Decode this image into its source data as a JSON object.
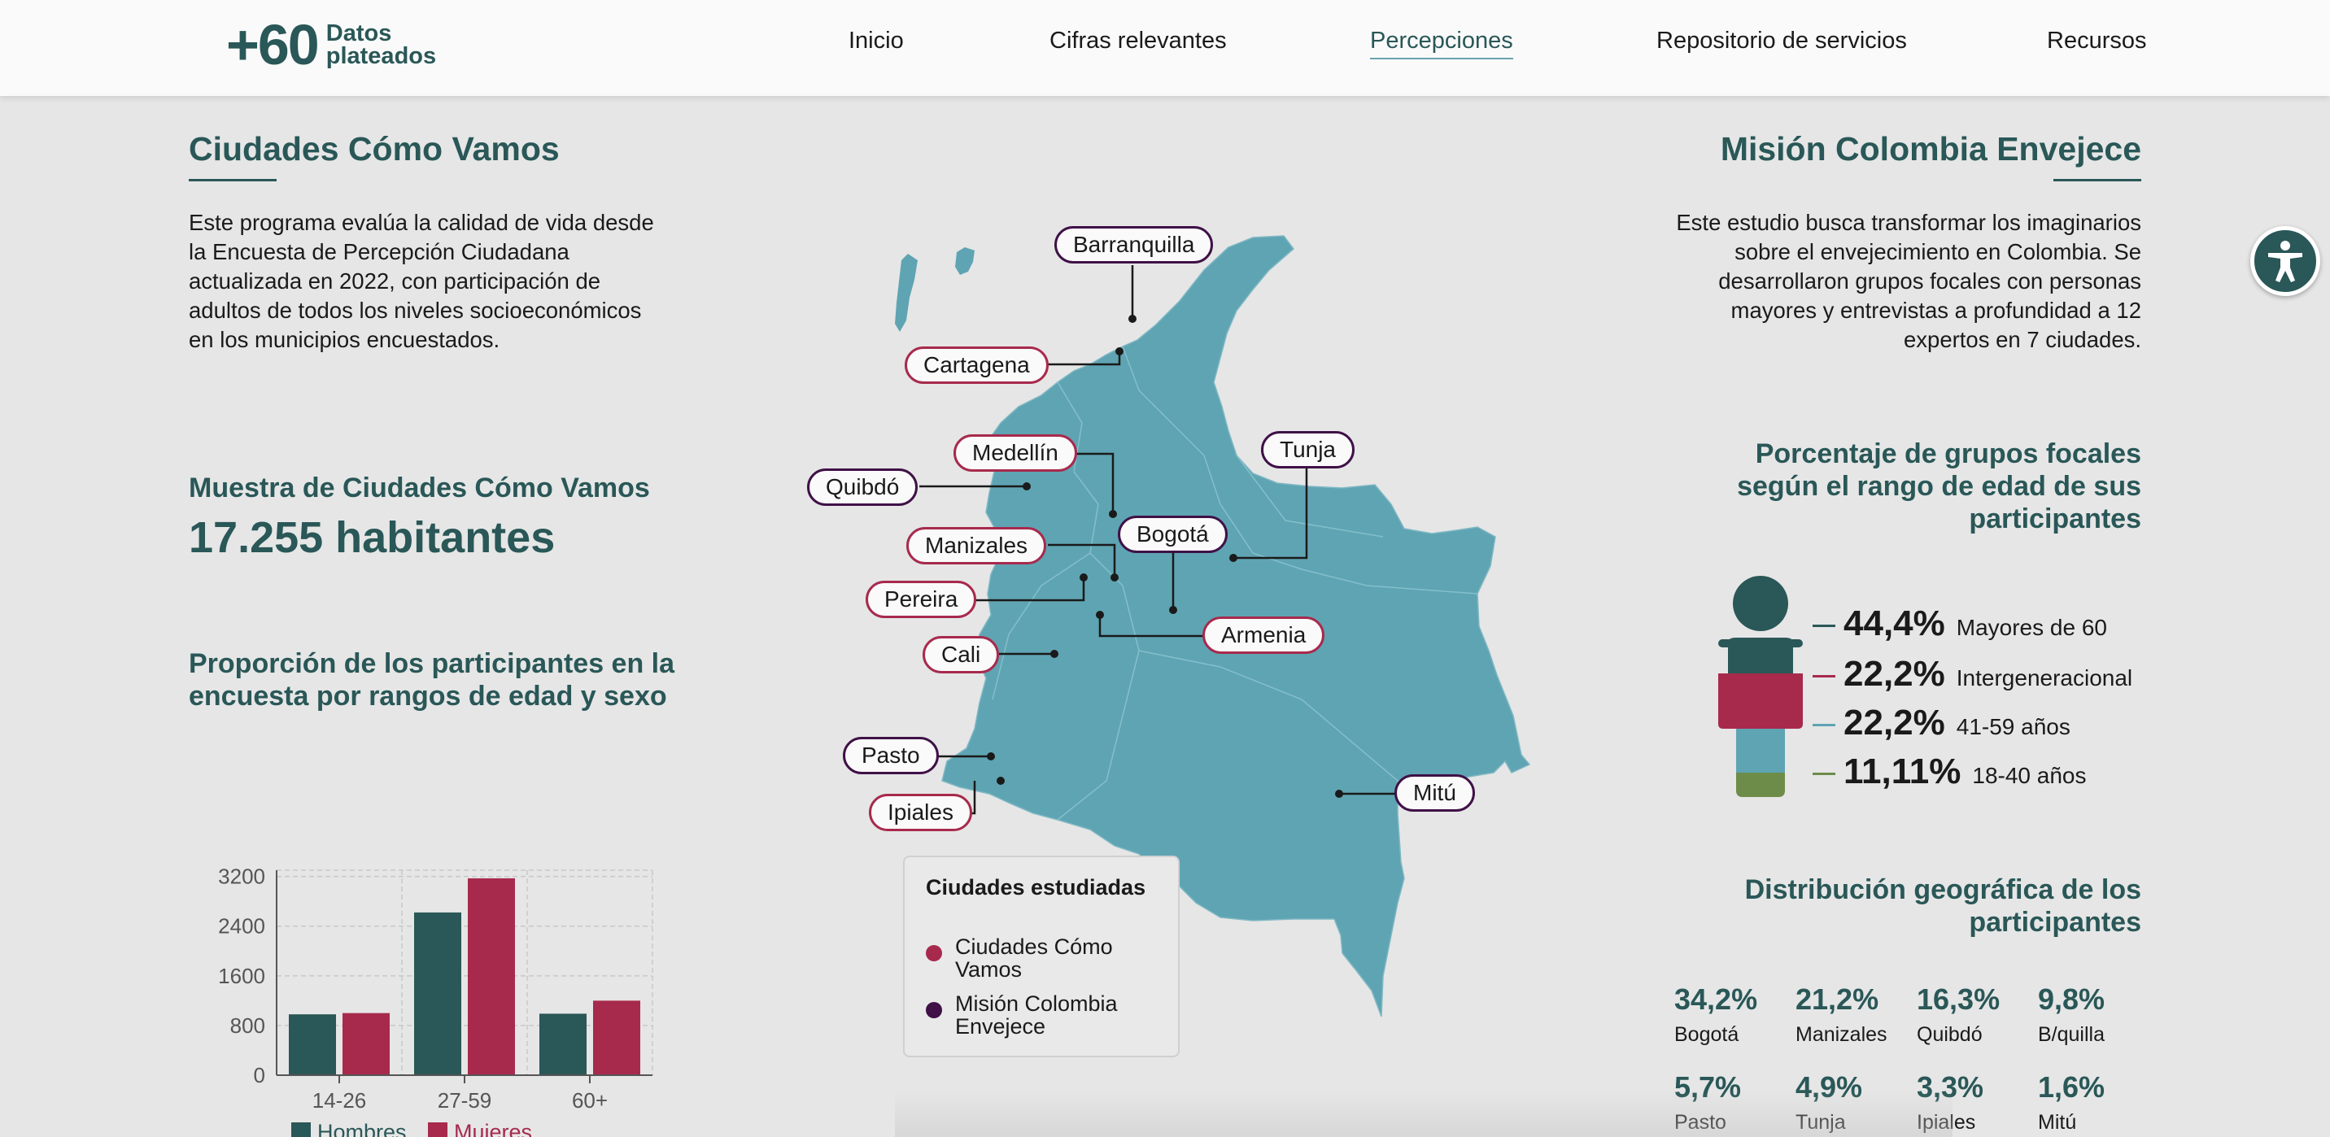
{
  "header": {
    "logo_number": "+60",
    "logo_line1": "Datos",
    "logo_line2": "plateados",
    "nav": [
      {
        "label": "Inicio",
        "active": false
      },
      {
        "label": "Cifras relevantes",
        "active": false
      },
      {
        "label": "Percepciones",
        "active": true
      },
      {
        "label": "Repositorio de servicios",
        "active": false
      },
      {
        "label": "Recursos",
        "active": false
      }
    ]
  },
  "left": {
    "title": "Ciudades Cómo Vamos",
    "description": "Este programa evalúa la calidad de vida desde la Encuesta de Percepción Ciudadana actualizada en 2022, con participación de adultos de todos los niveles socioeconómicos en los municipios encuestados.",
    "sample_title": "Muestra de Ciudades Cómo Vamos",
    "sample_value": "17.255 habitantes",
    "chart_title": "Proporción de los participantes en la encuesta por rangos de edad y sexo"
  },
  "chart_data": {
    "type": "bar",
    "title": "Proporción de los participantes en la encuesta por rangos de edad y sexo",
    "categories": [
      "14-26",
      "27-59",
      "60+"
    ],
    "series": [
      {
        "name": "Hombres",
        "color": "#2a5757",
        "values": [
          980,
          2620,
          990
        ]
      },
      {
        "name": "Mujeres",
        "color": "#a72a4d",
        "values": [
          1000,
          3170,
          1200
        ]
      }
    ],
    "yticks": [
      0,
      800,
      1600,
      2400,
      3200
    ],
    "ylim": [
      0,
      3300
    ],
    "grid": true,
    "legend": "bottom"
  },
  "map": {
    "fill_color": "#5fa4b3",
    "cities": [
      {
        "name": "Barranquilla",
        "group": "mision"
      },
      {
        "name": "Cartagena",
        "group": "ccv"
      },
      {
        "name": "Medellín",
        "group": "ccv"
      },
      {
        "name": "Quibdó",
        "group": "mision"
      },
      {
        "name": "Tunja",
        "group": "mision"
      },
      {
        "name": "Bogotá",
        "group": "mision"
      },
      {
        "name": "Manizales",
        "group": "ccv"
      },
      {
        "name": "Pereira",
        "group": "ccv"
      },
      {
        "name": "Armenia",
        "group": "ccv"
      },
      {
        "name": "Cali",
        "group": "ccv"
      },
      {
        "name": "Pasto",
        "group": "mision"
      },
      {
        "name": "Ipiales",
        "group": "ccv"
      },
      {
        "name": "Mitú",
        "group": "mision"
      }
    ],
    "legend": {
      "title": "Ciudades estudiadas",
      "items": [
        {
          "label": "Ciudades Cómo Vamos",
          "color": "#a72a4d"
        },
        {
          "label": "Misión Colombia Envejece",
          "color": "#3f1147"
        }
      ]
    }
  },
  "right": {
    "title": "Misión Colombia Envejece",
    "description": "Este estudio busca transformar los imaginarios sobre el envejecimiento en Colombia. Se desarrollaron grupos focales con personas mayores y entrevistas a profundidad a 12 expertos en 7 ciudades.",
    "focal_title": "Porcentaje de grupos focales según el rango de edad de sus participantes",
    "focal_groups": [
      {
        "value": "44,4%",
        "label": "Mayores de 60",
        "color": "#2a5757"
      },
      {
        "value": "22,2%",
        "label": "Intergeneracional",
        "color": "#a72a4d"
      },
      {
        "value": "22,2%",
        "label": "41-59 años",
        "color": "#5fa4b3"
      },
      {
        "value": "11,11%",
        "label": "18-40 años",
        "color": "#6d8c4a"
      }
    ],
    "geo_title": "Distribución geográfica de los participantes",
    "geo": [
      {
        "value": "34,2%",
        "city": "Bogotá"
      },
      {
        "value": "21,2%",
        "city": "Manizales"
      },
      {
        "value": "16,3%",
        "city": "Quibdó"
      },
      {
        "value": "9,8%",
        "city": "B/quilla"
      },
      {
        "value": "5,7%",
        "city": "Pasto"
      },
      {
        "value": "4,9%",
        "city": "Tunja"
      },
      {
        "value": "3,3%",
        "city": "Ipiales"
      },
      {
        "value": "1,6%",
        "city": "Mitú"
      }
    ]
  },
  "accessibility": {
    "icon": "accessibility-icon"
  }
}
